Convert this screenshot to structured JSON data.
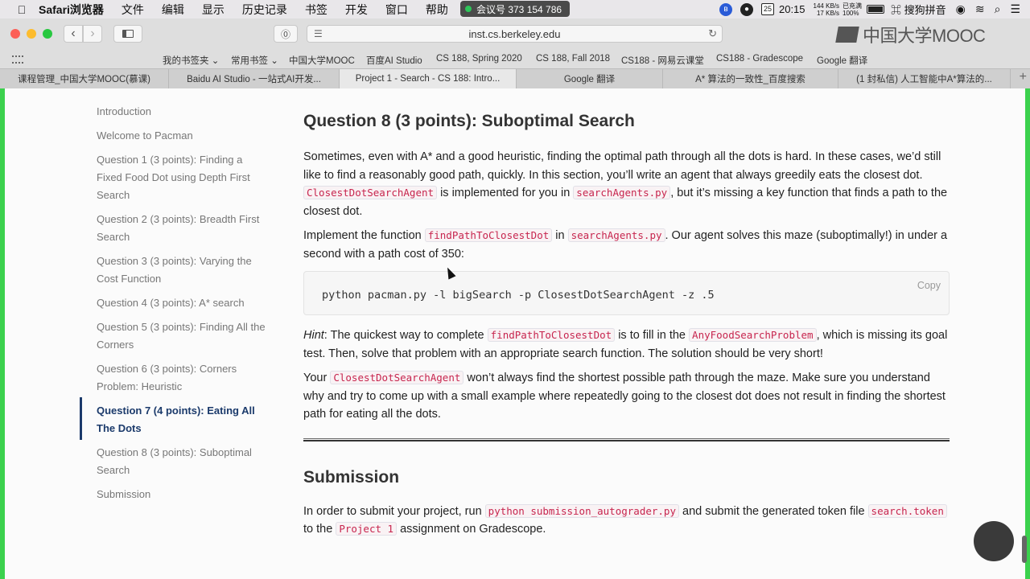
{
  "menubar": {
    "app": "Safari浏览器",
    "items": [
      "文件",
      "编辑",
      "显示",
      "历史记录",
      "书签",
      "开发",
      "窗口",
      "帮助"
    ],
    "meeting": "会议号 373 154 786",
    "date_day": "25",
    "time": "20:15",
    "net_up": "144 KB/s",
    "net_down": "17 KB/s",
    "battery_status": "已充满",
    "battery_pct": "100%",
    "ime": "搜狗拼音"
  },
  "toolbar": {
    "url": "inst.cs.berkeley.edu",
    "watermark": "中国大学MOOC"
  },
  "bookmarks": [
    "我的书签夹 ⌄",
    "常用书签 ⌄",
    "中国大学MOOC",
    "百度AI Studio",
    "CS 188, Spring 2020",
    "CS 188, Fall 2018",
    "CS188 - 网易云课堂",
    "CS188 - Gradescope",
    "Google 翻译"
  ],
  "tabs": [
    "课程管理_中国大学MOOC(慕课)",
    "Baidu AI Studio - 一站式AI开发...",
    "Project 1 - Search - CS 188: Intro...",
    "Google 翻译",
    "A* 算法的一致性_百度搜索",
    "(1 封私信) 人工智能中A*算法的..."
  ],
  "sidenav": [
    "Introduction",
    "Welcome to Pacman",
    "Question 1 (3 points): Finding a Fixed Food Dot using Depth First Search",
    "Question 2 (3 points): Breadth First Search",
    "Question 3 (3 points): Varying the Cost Function",
    "Question 4 (3 points): A* search",
    "Question 5 (3 points): Finding All the Corners",
    "Question 6 (3 points): Corners Problem: Heuristic",
    "Question 7 (4 points): Eating All The Dots",
    "Question 8 (3 points): Suboptimal Search",
    "Submission"
  ],
  "content": {
    "q8_title": "Question 8 (3 points): Suboptimal Search",
    "p1_text": "Sometimes, even with A* and a good heuristic, finding the optimal path through all the dots is hard. In these cases, we’d still like to find a reasonably good path, quickly. In this section, you’ll write an agent that always greedily eats the closest dot.",
    "p1_code1": "ClosestDotSearchAgent",
    "p1_mid": "is implemented for you in",
    "p1_code2": "searchAgents.py",
    "p1_end": ", but it’s missing a key function that finds a path to the closest dot.",
    "p2_start": "Implement the function",
    "p2_code1": "findPathToClosestDot",
    "p2_in": "in",
    "p2_code2": "searchAgents.py",
    "p2_end": ". Our agent solves this maze (suboptimally!) in under a second with a path cost of 350:",
    "command": "python pacman.py -l bigSearch -p ClosestDotSearchAgent -z .5",
    "copy_label": "Copy",
    "hint_label": "Hint",
    "hint_a": ": The quickest way to complete",
    "hint_code1": "findPathToClosestDot",
    "hint_b": "is to fill in the",
    "hint_code2": "AnyFoodSearchProblem",
    "hint_c": ", which is missing its goal test. Then, solve that problem with an appropriate search function. The solution should be very short!",
    "your_start": "Your",
    "your_code": "ClosestDotSearchAgent",
    "your_end": "won’t always find the shortest possible path through the maze. Make sure you understand why and try to come up with a small example where repeatedly going to the closest dot does not result in finding the shortest path for eating all the dots.",
    "submission_title": "Submission",
    "sub_a": "In order to submit your project, run",
    "sub_code1": "python submission_autograder.py",
    "sub_b": "and submit the generated token file",
    "sub_code2": "search.token",
    "sub_c": "to the",
    "sub_code3": "Project 1",
    "sub_d": "assignment on Gradescope."
  }
}
